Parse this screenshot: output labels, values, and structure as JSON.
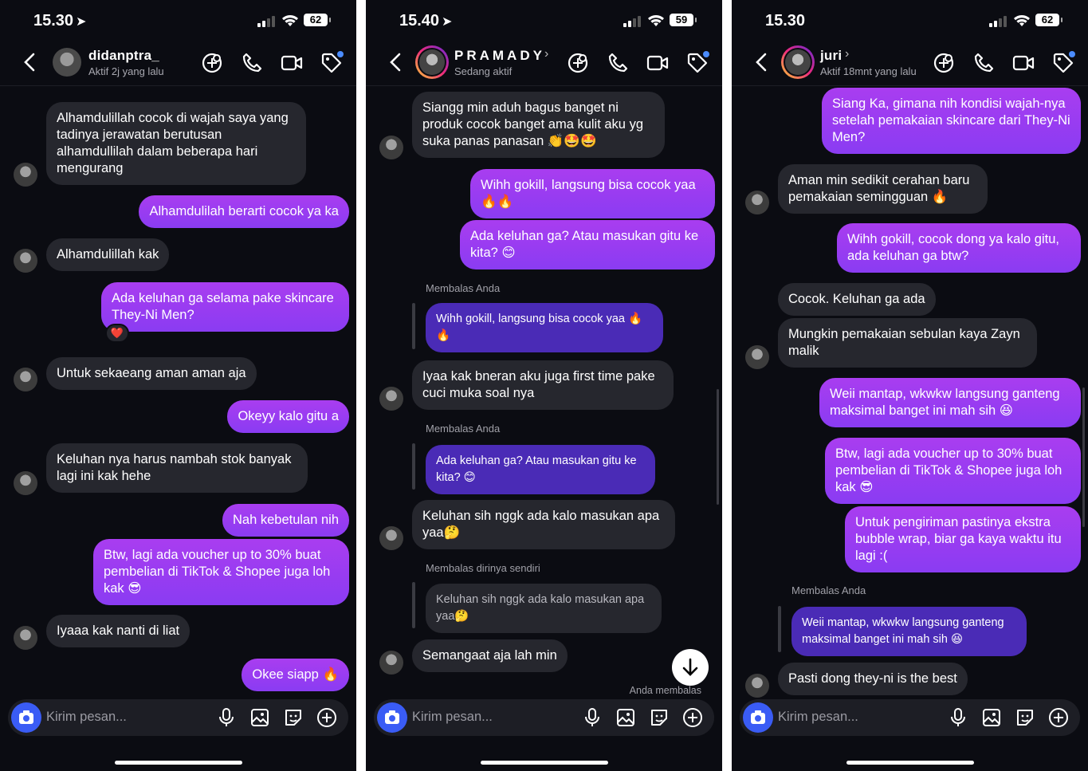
{
  "screens": [
    {
      "time": "15.30",
      "battery": "62",
      "contact": {
        "name": "didanptra_",
        "status": "Aktif 2j yang lalu"
      },
      "messages": [
        {
          "dir": "in",
          "text": "Alhamdulillah cocok di wajah saya yang tadinya jerawatan berutusan alhamdullilah dalam beberapa hari mengurang"
        },
        {
          "dir": "out",
          "text": "Alhamdulilah berarti cocok ya ka"
        },
        {
          "dir": "in",
          "text": "Alhamdulillah kak"
        },
        {
          "dir": "out",
          "text": "Ada keluhan ga selama pake skincare They-Ni Men?",
          "reaction": "❤️"
        },
        {
          "dir": "in",
          "text": "Untuk sekaeang aman aman aja"
        },
        {
          "dir": "out",
          "text": "Okeyy kalo gitu a"
        },
        {
          "dir": "in",
          "text": "Keluhan nya harus nambah stok banyak lagi ini kak hehe"
        },
        {
          "dir": "out",
          "text": "Nah kebetulan nih"
        },
        {
          "dir": "out",
          "text": "Btw, lagi ada voucher up to 30% buat pembelian di TikTok & Shopee juga loh kak 😎"
        },
        {
          "dir": "in",
          "text": "Iyaaa kak nanti di liat"
        },
        {
          "dir": "out",
          "text": "Okee siapp 🔥"
        }
      ],
      "composer_placeholder": "Kirim pesan..."
    },
    {
      "time": "15.40",
      "battery": "59",
      "contact": {
        "name": "PRAMADY",
        "status": "Sedang aktif"
      },
      "messages": [
        {
          "dir": "in",
          "text": "Siangg min aduh bagus banget ni produk cocok banget ama kulit aku yg suka panas panasan 👏🤩🤩"
        },
        {
          "dir": "out",
          "text": "Wihh gokill, langsung bisa cocok yaa 🔥🔥"
        },
        {
          "dir": "out",
          "text": "Ada keluhan ga? Atau masukan gitu ke kita? 😊"
        },
        {
          "dir": "label",
          "text": "Membalas Anda"
        },
        {
          "dir": "reply-out",
          "text": "Wihh gokill, langsung bisa cocok yaa 🔥 🔥"
        },
        {
          "dir": "in",
          "text": "Iyaa kak bneran aku juga first time pake cuci muka soal nya"
        },
        {
          "dir": "label",
          "text": "Membalas Anda"
        },
        {
          "dir": "reply-out",
          "text": "Ada keluhan ga? Atau masukan gitu ke kita? 😊"
        },
        {
          "dir": "in",
          "text": "Keluhan sih nggk ada kalo masukan apa yaa🤔"
        },
        {
          "dir": "label",
          "text": "Membalas dirinya sendiri"
        },
        {
          "dir": "reply-in",
          "text": "Keluhan sih nggk ada kalo masukan apa yaa🤔"
        },
        {
          "dir": "in",
          "text": "Semangaat aja lah min"
        },
        {
          "dir": "label",
          "text": "Anda membalas"
        }
      ],
      "composer_placeholder": "Kirim pesan..."
    },
    {
      "time": "15.30",
      "battery": "62",
      "contact": {
        "name": "juri",
        "status": "Aktif 18mnt yang lalu"
      },
      "messages": [
        {
          "dir": "out",
          "text": "Siang Ka, gimana nih kondisi wajah-nya setelah pemakaian skincare dari They-Ni Men?"
        },
        {
          "dir": "in",
          "text": "Aman min sedikit cerahan baru pemakaian semingguan 🔥"
        },
        {
          "dir": "out",
          "text": "Wihh gokill, cocok dong ya kalo gitu, ada keluhan ga btw?"
        },
        {
          "dir": "in",
          "text": "Cocok. Keluhan ga ada"
        },
        {
          "dir": "in",
          "text": "Mungkin pemakaian sebulan kaya Zayn malik"
        },
        {
          "dir": "out",
          "text": "Weii mantap, wkwkw langsung ganteng maksimal banget ini mah sih 😆"
        },
        {
          "dir": "out",
          "text": "Btw, lagi ada voucher up to 30% buat pembelian di TikTok & Shopee juga loh kak 😎"
        },
        {
          "dir": "out",
          "text": "Untuk pengiriman pastinya ekstra bubble wrap, biar ga kaya waktu itu lagi :("
        },
        {
          "dir": "label",
          "text": "Membalas Anda"
        },
        {
          "dir": "reply-out",
          "text": "Weii mantap, wkwkw langsung ganteng maksimal banget ini mah sih 😆"
        },
        {
          "dir": "in",
          "text": "Pasti dong they-ni is the best"
        }
      ],
      "composer_placeholder": "Kirim pesan..."
    }
  ]
}
